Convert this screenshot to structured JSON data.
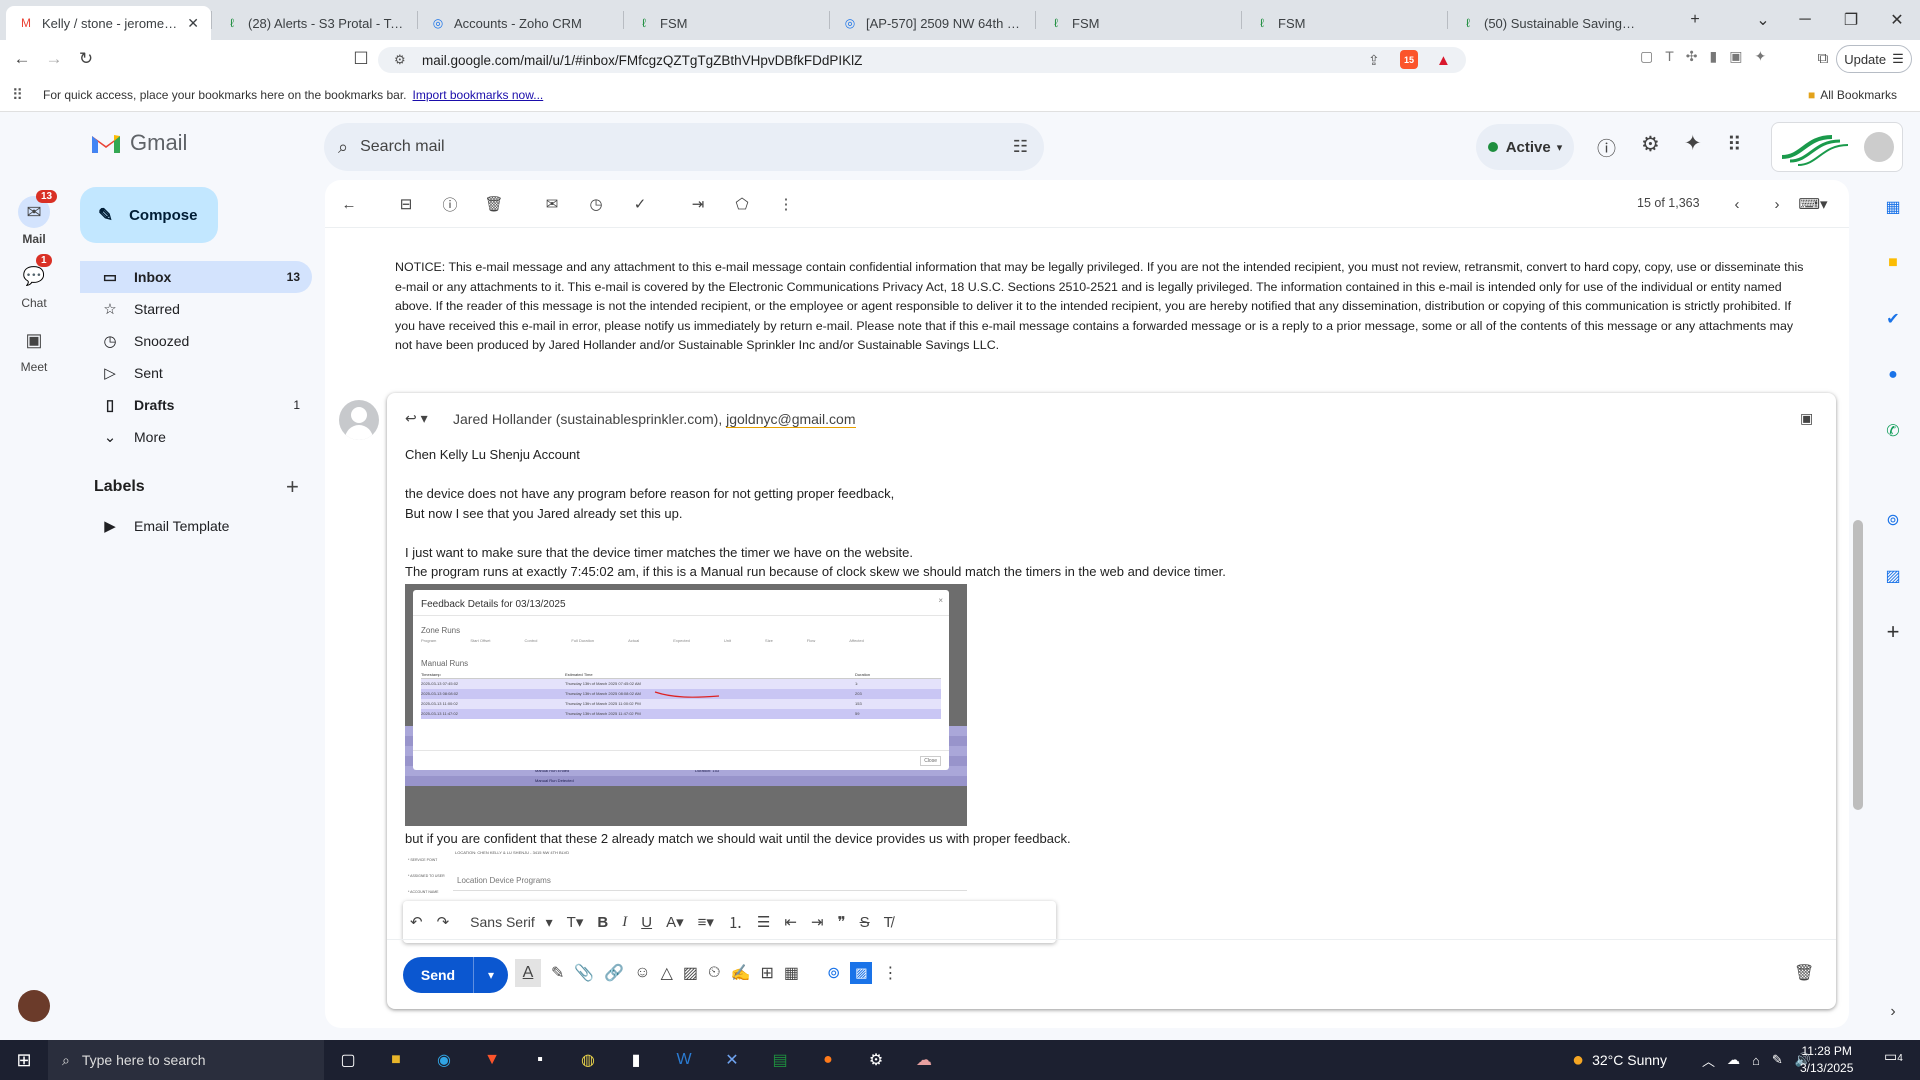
{
  "tabs": [
    {
      "title": "Kelly / stone - jerome@su",
      "active": true,
      "icon": "gmail-icon"
    },
    {
      "title": "(28) Alerts - S3 Protal - Tasks",
      "icon": "fsm-icon"
    },
    {
      "title": "Accounts - Zoho CRM",
      "icon": "zoho-icon"
    },
    {
      "title": "FSM",
      "icon": "fsm-icon"
    },
    {
      "title": "[AP-570] 2509 NW 64th Blvd",
      "icon": "jira-icon"
    },
    {
      "title": "FSM",
      "icon": "fsm-icon"
    },
    {
      "title": "FSM",
      "icon": "fsm-icon"
    },
    {
      "title": "(50) Sustainable Savings, LLC",
      "icon": "fsm-icon"
    }
  ],
  "browser": {
    "url": "mail.google.com/mail/u/1/#inbox/FMfcgzQZTgTgZBthVHpvDBfkFDdPIKlZ",
    "update_label": "Update",
    "bookmarks_hint": "For quick access, place your bookmarks here on the bookmarks bar.",
    "import_link": "Import bookmarks now...",
    "all_bookmarks": "All Bookmarks",
    "brave_badge": "15"
  },
  "gmail": {
    "logo_text": "Gmail",
    "search_placeholder": "Search mail",
    "status": "Active",
    "compose_label": "Compose",
    "rail": [
      {
        "label": "Mail",
        "badge": "13"
      },
      {
        "label": "Chat",
        "badge": "1"
      },
      {
        "label": "Meet",
        "badge": ""
      }
    ],
    "nav": [
      {
        "label": "Inbox",
        "count": "13"
      },
      {
        "label": "Starred",
        "count": ""
      },
      {
        "label": "Snoozed",
        "count": ""
      },
      {
        "label": "Sent",
        "count": ""
      },
      {
        "label": "Drafts",
        "count": "1"
      },
      {
        "label": "More",
        "count": ""
      }
    ],
    "labels_heading": "Labels",
    "labels": [
      {
        "label": "Email Template"
      }
    ],
    "pagination": "15 of 1,363"
  },
  "message": {
    "notice": "NOTICE: This e-mail message and any attachment to this e-mail message contain confidential information that may be legally privileged. If you are not the intended recipient, you must not review, retransmit, convert to hard copy, copy, use or disseminate this e-mail or any attachments to it. This e-mail is covered by the Electronic Communications Privacy Act, 18 U.S.C. Sections 2510-2521 and is legally privileged. The information contained in this e-mail is intended only for use of the individual or entity named above. If the reader of this message is not the intended recipient, or the employee or agent responsible to deliver it to the intended recipient, you are hereby notified that any dissemination, distribution or copying of this communication is strictly prohibited. If you have received this e-mail in error, please notify us immediately by return e-mail. Please note that if this e-mail message contains a forwarded message or is a reply to a prior message, some or all of the contents of this message or any attachments may not have been produced by Jared Hollander and/or Sustainable Sprinkler Inc and/or Sustainable Savings LLC."
  },
  "reply": {
    "recipient1": "Jared Hollander (sustainablesprinkler.com),",
    "recipient2": "jgoldnyc@gmail.com",
    "lines": [
      "Chen Kelly  Lu Shenju Account",
      "",
      "the device does not have any program before reason for not getting proper feedback,",
      "But now I see that you Jared already set this up.",
      "",
      "I just want to make sure that the device timer matches the timer we have on the website.",
      "The program runs at exactly 7:45:02 am,  if this is a Manual run because of clock skew we should match the timers in the web and device timer."
    ],
    "after_image": "but if you are confident that these 2 already match we should wait until the device provides us with proper feedback.",
    "screenshot1": {
      "title": "Feedback Details for 03/13/2025",
      "zone_runs": "Zone Runs",
      "zone_cols": [
        "Program",
        "Start Offset",
        "Control",
        "Full Duration",
        "Actual",
        "Expected",
        "Unit",
        "Size",
        "Flow",
        "Affected"
      ],
      "manual_runs": "Manual Runs",
      "manual_cols": [
        "Timestamp",
        "Estimated Time",
        "Duration"
      ],
      "manual_rows": [
        [
          "2025-03-13 07:45:02",
          "Thursday 13th of March 2025 07:45:02 AM",
          "1:"
        ],
        [
          "2025-03-13 08:08:02",
          "Thursday 13th of March 2025 08:08:02 AM",
          "203"
        ],
        [
          "2025-03-13 11:00:02",
          "Thursday 13th of March 2025 11:00:02 PM",
          "153"
        ],
        [
          "2025-03-13 11:47:02",
          "Thursday 13th of March 2025 11:47:02 PM",
          "59"
        ]
      ],
      "close": "Close",
      "bg_rows": [
        [
          "Manual Run Ended",
          "Duration: 21"
        ],
        [
          "Manual Run Detected",
          ""
        ],
        [
          "Manual Run Ended",
          "Duration: 153"
        ],
        [
          "Manual Run Detected",
          ""
        ],
        [
          "Manual Run Ended",
          "Duration: 153"
        ],
        [
          "Manual Run Detected",
          ""
        ]
      ]
    },
    "screenshot2": {
      "header": "LOCATION: CHEN KELLY & LU SHENJU - 3415 NW 4TH BLVD",
      "section": "Location Device Programs",
      "left_labels": [
        "* SERVICE POINT",
        "* ASSIGNED TO USER",
        "* ACCOUNT NAME"
      ]
    },
    "font_label": "Sans Serif",
    "send_label": "Send"
  },
  "taskbar": {
    "search_placeholder": "Type here to search",
    "weather": "32°C  Sunny",
    "time": "11:28 PM",
    "date": "3/13/2025",
    "notif_count": "4"
  },
  "colors": {
    "accent": "#0b57d0",
    "selected_nav": "#d3e3fd",
    "badge": "#d93025"
  }
}
